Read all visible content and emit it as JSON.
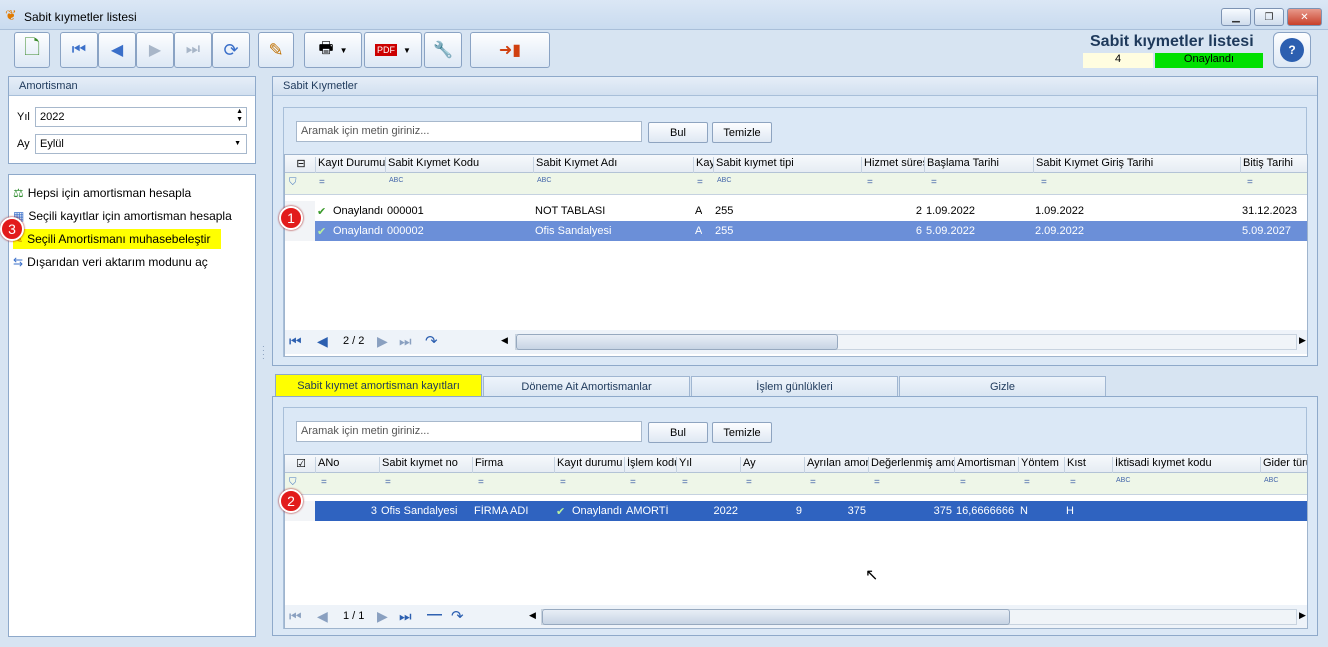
{
  "window": {
    "title": "Sabit kıymetler listesi"
  },
  "header": {
    "title": "Sabit kıymetler listesi",
    "count": "4",
    "status": "Onaylandı",
    "status_color": "#00e000"
  },
  "left": {
    "group_title": "Amortisman",
    "year_label": "Yıl",
    "year_value": "2022",
    "month_label": "Ay",
    "month_value": "Eylül",
    "actions": [
      {
        "label": "Hepsi için amortisman hesapla",
        "icon": "calc-icon"
      },
      {
        "label": "Seçili kayıtlar için amortisman hesapla",
        "icon": "grid-calc-icon"
      },
      {
        "label": "Seçili Amortismanı muhasebeleştir",
        "icon": "post-icon"
      },
      {
        "label": "Dışarıdan veri aktarım modunu aç",
        "icon": "import-icon"
      }
    ]
  },
  "top_grid": {
    "title": "Sabit Kıymetler",
    "search_placeholder": "Aramak için metin giriniz...",
    "find_label": "Bul",
    "clear_label": "Temizle",
    "columns": [
      "Kayıt Durumu",
      "Sabit Kıymet Kodu",
      "Sabit Kıymet Adı",
      "Kay",
      "Sabit kıymet tipi",
      "Hizmet süresi",
      "Başlama Tarihi",
      "Sabit Kıymet Giriş Tarihi",
      "Bitiş Tarihi"
    ],
    "filter_marks": [
      "=",
      "ABC",
      "ABC",
      "=",
      "ABC",
      "=",
      "=",
      "=",
      "="
    ],
    "rows": [
      [
        "Onaylandı",
        "000001",
        "NOT TABLASI",
        "A",
        "255",
        "2",
        "1.09.2022",
        "1.09.2022",
        "31.12.2023"
      ],
      [
        "Onaylandı",
        "000002",
        "Ofis Sandalyesi",
        "A",
        "255",
        "6",
        "5.09.2022",
        "2.09.2022",
        "5.09.2027"
      ]
    ],
    "pager": "2 / 2"
  },
  "tabs": [
    "Sabit kıymet amortisman kayıtları",
    "Döneme Ait Amortismanlar",
    "İşlem günlükleri",
    "Gizle"
  ],
  "bottom_grid": {
    "search_placeholder": "Aramak için metin giriniz...",
    "find_label": "Bul",
    "clear_label": "Temizle",
    "columns": [
      "ANo",
      "Sabit kıymet no",
      "Firma",
      "Kayıt durumu",
      "İşlem kodu",
      "Yıl",
      "Ay",
      "Ayrılan amortisman",
      "Değerlenmiş amortisman",
      "Amortisman",
      "Yöntem",
      "Kıst",
      "İktisadi kıymet kodu",
      "Gider türü"
    ],
    "filter_marks": [
      "=",
      "=",
      "=",
      "=",
      "=",
      "=",
      "=",
      "=",
      "=",
      "=",
      "=",
      "=",
      "ABC",
      "ABC"
    ],
    "rows": [
      [
        "3",
        "Ofis Sandalyesi",
        "FİRMA ADI",
        "Onaylandı",
        "AMORTİ",
        "2022",
        "9",
        "375",
        "375",
        "16,6666666",
        "N",
        "H",
        "",
        ""
      ]
    ],
    "pager": "1 / 1"
  },
  "badges": [
    "1",
    "2",
    "3"
  ],
  "highlight_color": "#ffff00"
}
